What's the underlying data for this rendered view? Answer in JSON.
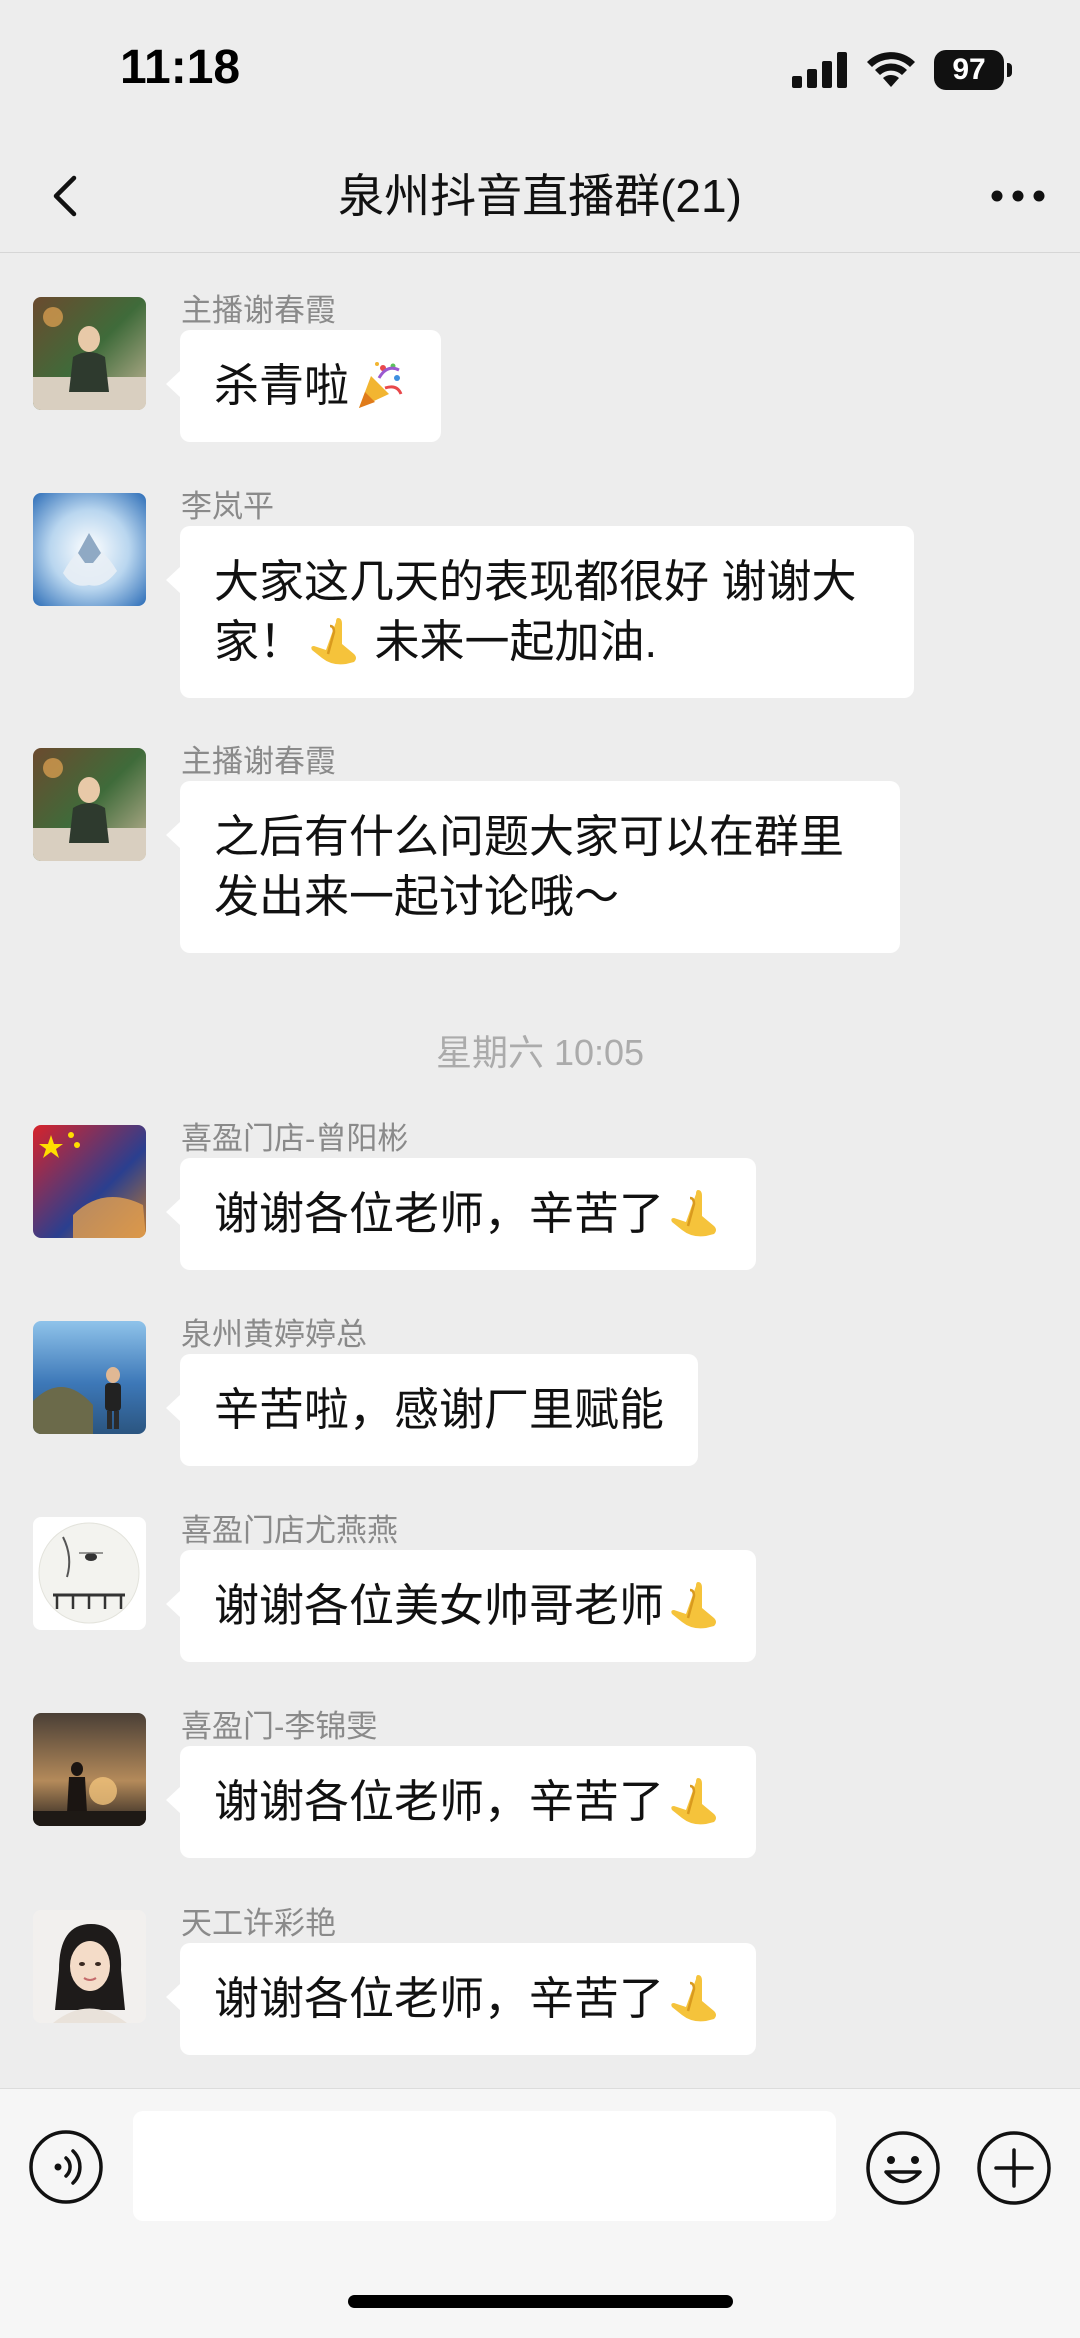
{
  "status_bar": {
    "time": "11:18",
    "battery": "97"
  },
  "nav": {
    "title": "泉州抖音直播群(21)"
  },
  "messages": [
    {
      "sender": "主播谢春霞",
      "text": "杀青啦",
      "emoji": "party-popper"
    },
    {
      "sender": "李岚平",
      "text_line1": "大家这几天的表现都很好 谢谢大",
      "text_line2_a": "家！",
      "emoji": "praying-hands",
      "text_line2_b": " 未来一起加油."
    },
    {
      "sender": "主播谢春霞",
      "text_line1": "之后有什么问题大家可以在群里",
      "text_line2": "发出来一起讨论哦～"
    },
    {
      "sender": "喜盈门店-曾阳彬",
      "text": "谢谢各位老师，辛苦了",
      "emoji": "praying-hands"
    },
    {
      "sender": "泉州黄婷婷总",
      "text": "辛苦啦，感谢厂里赋能"
    },
    {
      "sender": "喜盈门店尤燕燕",
      "text": "谢谢各位美女帅哥老师",
      "emoji": "praying-hands"
    },
    {
      "sender": "喜盈门-李锦雯",
      "text": "谢谢各位老师，辛苦了",
      "emoji": "praying-hands"
    },
    {
      "sender": "天工许彩艳",
      "text": "谢谢各位老师，辛苦了",
      "emoji": "praying-hands"
    }
  ],
  "timestamp": "星期六 10:05",
  "input": {
    "placeholder": "",
    "value": ""
  },
  "colors": {
    "background": "#ededed",
    "bubble": "#ffffff",
    "sender_name": "#8a8a8a",
    "timestamp": "#ababab"
  }
}
